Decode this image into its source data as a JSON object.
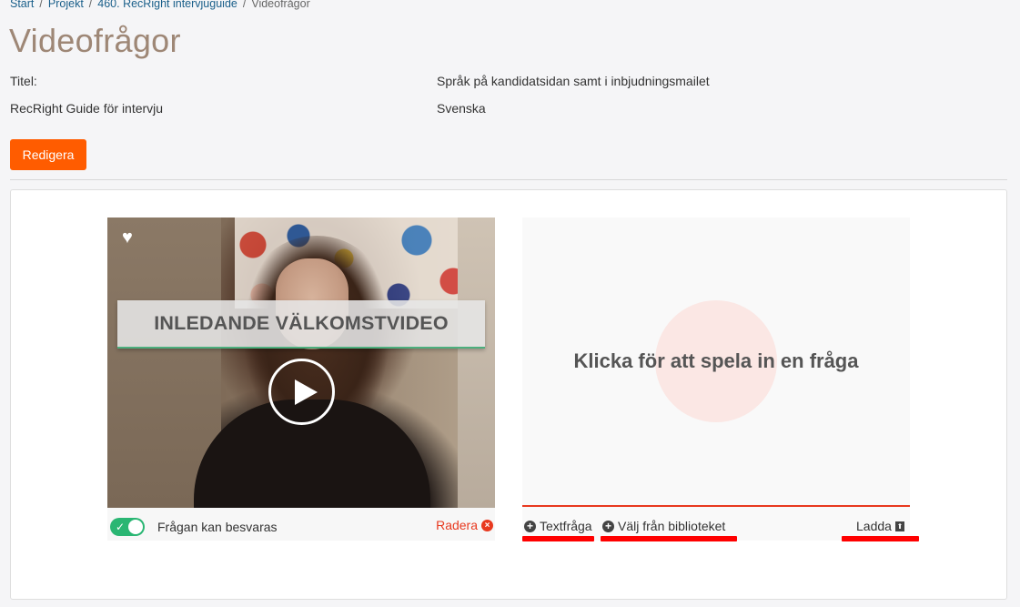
{
  "breadcrumb": {
    "items": [
      "Start",
      "Projekt",
      "460. RecRight intervjuguide"
    ],
    "current": "Videofrågor",
    "separator": "/"
  },
  "page": {
    "title": "Videofrågor"
  },
  "meta": {
    "title_label": "Titel:",
    "title_value": "RecRight Guide för intervju",
    "language_label": "Språk på kandidatsidan samt i inbjudningsmailet",
    "language_value": "Svenska"
  },
  "actions": {
    "edit_label": "Redigera"
  },
  "video_question": {
    "banner_text": "INLEDANDE VÄLKOMSTVIDEO",
    "toggle_on": true,
    "toggle_label": "Frågan kan besvaras",
    "delete_label": "Radera"
  },
  "record_card": {
    "prompt": "Klicka för att spela in en fråga",
    "options": {
      "text_question": "Textfråga",
      "from_library": "Välj från biblioteket",
      "upload": "Ladda"
    }
  },
  "colors": {
    "accent": "#ff5c00",
    "danger": "#e8391f",
    "toggle": "#2ab673",
    "title": "#9e8776",
    "annotation": "#ff0000"
  }
}
